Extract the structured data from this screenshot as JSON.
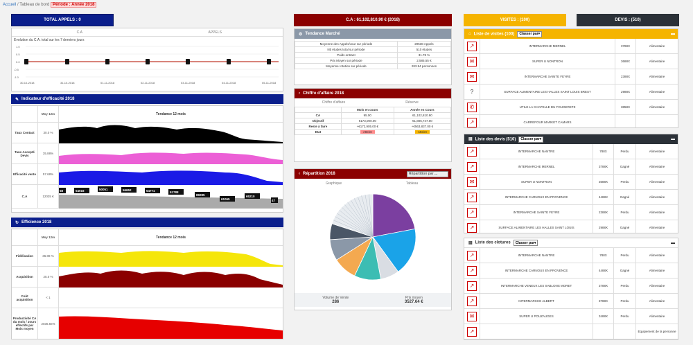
{
  "breadcrumb": {
    "home": "Accueil",
    "sep": "/",
    "current": "Tableau de bord",
    "period": "Période : Année 2018"
  },
  "top": {
    "appels_tab": "TOTAL APPELS : 0",
    "ca_tab": "C.A : 61,102,810.90 € (2018)",
    "visites_tab": "VISITES : (100)",
    "devis_tab": "DEVIS : (510)"
  },
  "evolution": {
    "tab_ca": "C.A",
    "tab_appels": "APPELS",
    "title": "Evolution du C.A. total sur les 7 derniers jours",
    "yticks": [
      "1.0",
      "0.5",
      "0.0",
      "-0.5",
      "-1.0"
    ],
    "dates": [
      "30-10-2018",
      "31-10-2018",
      "01-11-2018",
      "02-11-2018",
      "03-11-2018",
      "04-11-2018",
      "05-11-2018"
    ]
  },
  "efficacite": {
    "header": "Indicateur d'efficacité 2018",
    "col_moy": "Moy 12m",
    "col_tendance": "Tendance 12 mois",
    "rows": [
      {
        "label": "Taux Contact",
        "value": "30.0 %"
      },
      {
        "label": "Taux Accepté Devis",
        "value": "35.88%"
      },
      {
        "label": "Efficacité vente",
        "value": "57.68%"
      },
      {
        "label": "C.A",
        "value": "12035 €"
      }
    ],
    "ca_labels": [
      "58",
      "54016",
      "50051",
      "56652",
      "54771",
      "51788",
      "89285",
      "61065",
      "65210",
      "47"
    ]
  },
  "efficience": {
    "header": "Efficience 2018",
    "col_moy": "Moy 12m",
    "col_tendance": "Tendance 12 mois",
    "rows": [
      {
        "label": "Fidélisation",
        "value": "36.08 %"
      },
      {
        "label": "Acquisition",
        "value": "25.0 %"
      },
      {
        "label": "Coût acquisition",
        "value": "< 1"
      },
      {
        "label": "Productivité CA du mois / Jours effectifs par Mois moyen",
        "value": "2036.59 €"
      }
    ]
  },
  "tendance_marche": {
    "header": "Tendance Marché",
    "rows": [
      {
        "k": "Moyenne des Appels/Jour sur période",
        "v": "20538 Appels"
      },
      {
        "k": "Nb études total sur période",
        "v": "510 études"
      },
      {
        "k": "Poids entrant",
        "v": "31.78 %"
      },
      {
        "k": "Prix Moyen sur période",
        "v": "2,585.55 €"
      },
      {
        "k": "Moyenne rotation sur période",
        "v": "283.94 personnes"
      }
    ]
  },
  "chiffre_affaire": {
    "header": "Chiffre d'affaire 2018",
    "sub_left": "Chiffre d'affaire",
    "sub_right": "Réserve",
    "col1": "Mois en cours",
    "col2": "Année en Cours",
    "rows": [
      {
        "k": "CA",
        "a": "95.00",
        "b": "61,102,810.90"
      },
      {
        "k": "Objectif",
        "a": "€173,000.00",
        "b": "€1,806,747.00"
      },
      {
        "k": "Reste à faire",
        "a": "+€172,905.00 €",
        "b": "+€563,837.00 €"
      },
      {
        "k": "Etat",
        "a": "Atteint",
        "b": "Atteint"
      }
    ]
  },
  "repartition": {
    "header": "Répartition 2018",
    "select": "Répartition par ...",
    "tab_graph": "Graphique",
    "tab_table": "Tableau",
    "foot_left_label": "Volume de Vente",
    "foot_left_value": "286",
    "foot_right_label": "Prix moyen",
    "foot_right_value": "3527.64 €"
  },
  "pie_colors": [
    "#7b3fa0",
    "#1aa3e8",
    "#d9dde3",
    "#3cbdb3",
    "#f4a950",
    "#8b98a8",
    "#4a5666",
    "#e8ecf0"
  ],
  "visites": {
    "header": "Liste de visites (100)",
    "select": "Classer par",
    "rows": [
      {
        "icon": "↗",
        "name": "INTERMARCHE MERNEL",
        "cp": "3788X",
        "cat": "Alimentaire"
      },
      {
        "icon": "✉",
        "name": "SUPER U NONTRON",
        "cp": "3688X",
        "cat": "Alimentaire"
      },
      {
        "icon": "✉",
        "name": "INTERMARCHE SAINTE FEYRE",
        "cp": "2388X",
        "cat": "Alimentaire"
      },
      {
        "icon": "?",
        "name": "SURFACE ALIMENTAIRE LES HALLES SAINT LOUIS BREST",
        "cp": "2988X",
        "cat": "Alimentaire"
      },
      {
        "icon": "✆",
        "name": "UTILE LA CHAPELLE DU FOUGERETZ",
        "cp": "3858X",
        "cat": "Alimentaire"
      },
      {
        "icon": "↗",
        "name": "CARREFOUR MARKET CAMARS",
        "cp": "",
        "cat": ""
      }
    ]
  },
  "devis": {
    "header": "Liste des devis (510)",
    "select": "Classer par",
    "rows": [
      {
        "icon": "↗",
        "name": "INTERMARCHE NANTRE",
        "cp": "788X",
        "st": "Perdu",
        "cat": "Alimentaire"
      },
      {
        "icon": "↗",
        "name": "INTERMARCHE MERNEL",
        "cp": "3788X",
        "st": "Gagné",
        "cat": "Alimentaire"
      },
      {
        "icon": "✉",
        "name": "SUPER U NONTRON",
        "cp": "3688X",
        "st": "Perdu",
        "cat": "Alimentaire"
      },
      {
        "icon": "↗",
        "name": "INTERMARCHE CARNOUX EN PROVENCE",
        "cp": "4488X",
        "st": "Gagné",
        "cat": "Alimentaire"
      },
      {
        "icon": "↗",
        "name": "INTERMARCHE SAINTE FEYRE",
        "cp": "2388X",
        "st": "Perdu",
        "cat": "Alimentaire"
      },
      {
        "icon": "↗",
        "name": "SURFACE ALIMENTAIRE LES HALLES SAINT LOUIS",
        "cp": "2988X",
        "st": "Gagné",
        "cat": "Alimentaire"
      }
    ]
  },
  "clotures": {
    "header": "Liste des clotures",
    "select": "Classer par",
    "rows": [
      {
        "icon": "↗",
        "name": "INTERMARCHE NANTRE",
        "cp": "788X",
        "st": "Perdu",
        "cat": "Alimentaire"
      },
      {
        "icon": "↗",
        "name": "INTERMARCHE CARNOUX EN PROVENCE",
        "cp": "4488X",
        "st": "Gagné",
        "cat": "Alimentaire"
      },
      {
        "icon": "↗",
        "name": "INTERMARCHE VENEUX LES SABLONS MORET",
        "cp": "3788X",
        "st": "Perdu",
        "cat": "Alimentaire"
      },
      {
        "icon": "↗",
        "name": "INTERMARCHE ALBERT",
        "cp": "3788X",
        "st": "Perdu",
        "cat": "Alimentaire"
      },
      {
        "icon": "✉",
        "name": "SUPER U POUZAUGES",
        "cp": "3488X",
        "st": "Perdu",
        "cat": "Alimentaire"
      },
      {
        "icon": "↗",
        "name": "",
        "cp": "",
        "st": "",
        "cat": "Equipement de la personne"
      }
    ]
  }
}
